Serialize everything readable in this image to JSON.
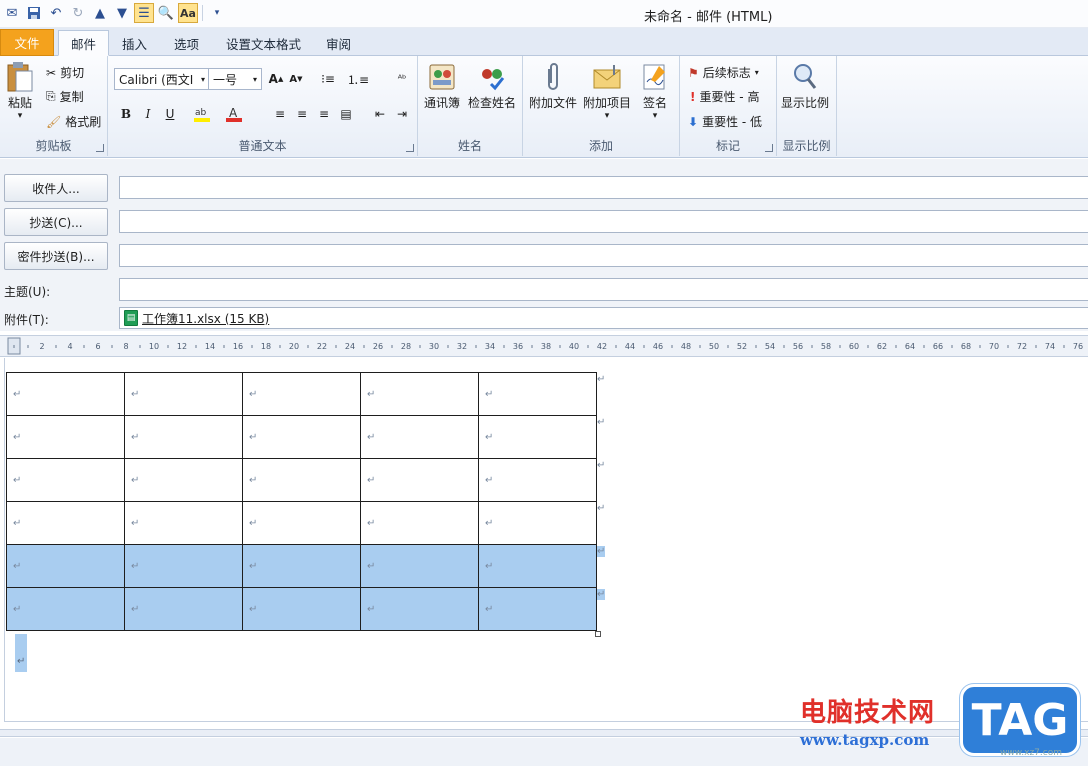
{
  "window": {
    "title": "未命名  -  邮件 (HTML)"
  },
  "tabs": {
    "file": "文件",
    "items": [
      "邮件",
      "插入",
      "选项",
      "设置文本格式",
      "审阅"
    ]
  },
  "ribbon": {
    "clipboard": {
      "label": "剪贴板",
      "paste": "粘贴",
      "cut": "剪切",
      "copy": "复制",
      "format_painter": "格式刷"
    },
    "basic_text": {
      "label": "普通文本",
      "font": "Calibri (西文I",
      "size": "一号",
      "bold": "B",
      "italic": "I",
      "underline": "U"
    },
    "names": {
      "label": "姓名",
      "address_book": "通讯簿",
      "check_names": "检查姓名"
    },
    "include": {
      "label": "添加",
      "attach_file": "附加文件",
      "attach_item": "附加项目",
      "signature": "签名"
    },
    "tags": {
      "label": "标记",
      "follow_up": "后续标志",
      "high": "重要性 - 高",
      "low": "重要性 - 低"
    },
    "zoom": {
      "label": "显示比例",
      "zoom_btn": "显示比例"
    }
  },
  "fields": {
    "to": "收件人...",
    "cc": "抄送(C)...",
    "bcc": "密件抄送(B)...",
    "subject": "主题(U):",
    "attachment_label": "附件(T):",
    "attachment_file": "工作簿11.xlsx (15 KB)"
  },
  "ruler": {
    "ticks": [
      "2",
      "4",
      "6",
      "8",
      "10",
      "12",
      "14",
      "16",
      "18",
      "20",
      "22",
      "24",
      "26",
      "28",
      "30",
      "32",
      "34",
      "36",
      "38",
      "40",
      "42",
      "44",
      "46",
      "48",
      "50",
      "52",
      "54",
      "56",
      "58",
      "60",
      "62",
      "64",
      "66",
      "68",
      "70",
      "72",
      "74",
      "76"
    ]
  },
  "table": {
    "rows": 6,
    "cols": 5,
    "selected_rows": [
      4,
      5
    ],
    "cell_mark": "↵"
  },
  "watermark": {
    "site_name": "电脑技术网",
    "url": "www.tagxp.com",
    "tag": "TAG",
    "url2": "www.xz7.com"
  },
  "colors": {
    "file_tab": "#f4a21d",
    "selection": "#a9cdf0",
    "watermark_red": "#e0302a",
    "watermark_blue": "#2f7fd8"
  }
}
